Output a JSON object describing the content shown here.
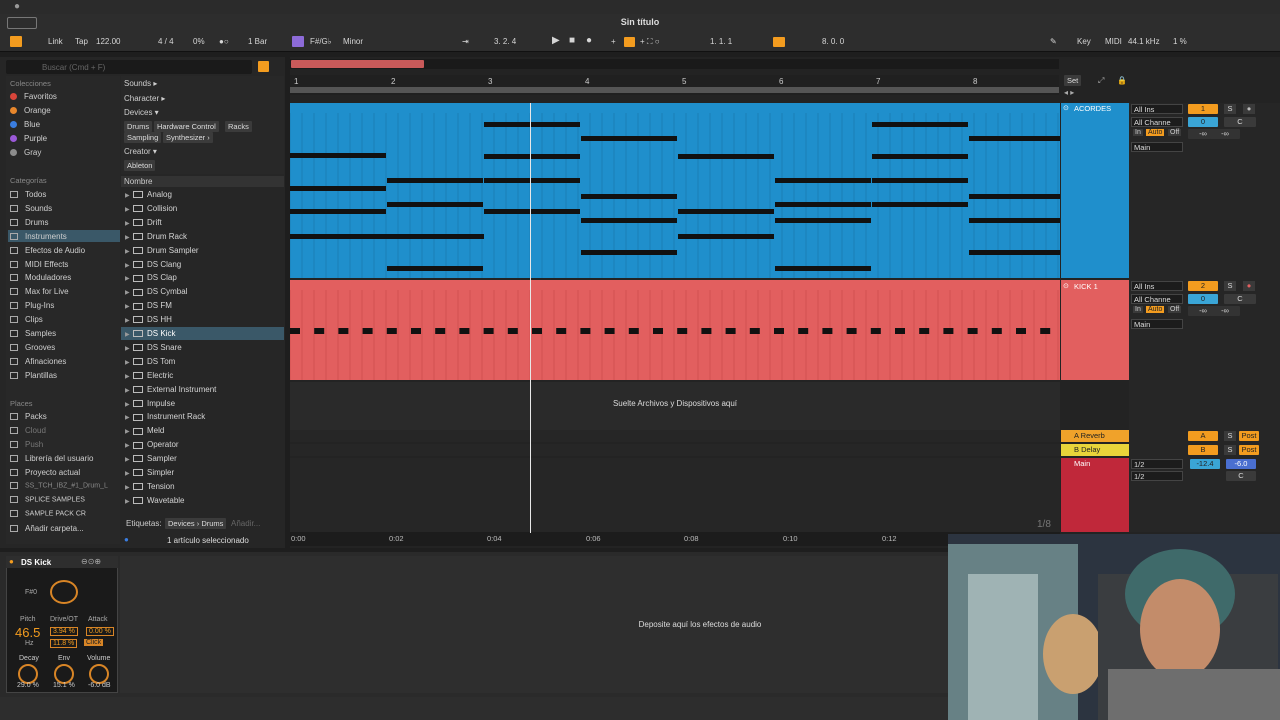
{
  "app": {
    "title": "Sin título"
  },
  "control_bar": {
    "link": "Link",
    "tap": "Tap",
    "tempo": "122.00",
    "signature": "4 / 4",
    "percent": "0%",
    "quantize": "1 Bar",
    "key": "F#/G♭",
    "scale": "Minor",
    "position": "3.  2.  4",
    "loop_start": "1.  1.  1",
    "loop_length": "8.  0.  0",
    "key_btn": "Key",
    "midi_btn": "MIDI",
    "sample_rate": "44.1 kHz",
    "cpu": "1 %"
  },
  "browser": {
    "search_placeholder": "Buscar (Cmd + F)",
    "collections_head": "Colecciones",
    "collections": [
      {
        "label": "Favoritos",
        "color": "#d8453a"
      },
      {
        "label": "Orange",
        "color": "#e8872c"
      },
      {
        "label": "Blue",
        "color": "#3a7de0"
      },
      {
        "label": "Purple",
        "color": "#9b59d8"
      },
      {
        "label": "Gray",
        "color": "#8c8c8c"
      }
    ],
    "categories_head": "Categorías",
    "categories": [
      "Todos",
      "Sounds",
      "Drums",
      "Instruments",
      "Efectos de Audio",
      "MIDI Effects",
      "Moduladores",
      "Max for Live",
      "Plug-Ins",
      "Clips",
      "Samples",
      "Grooves",
      "Afinaciones",
      "Plantillas"
    ],
    "places_head": "Places",
    "places": [
      "Packs",
      "Cloud",
      "Push",
      "Librería del usuario",
      "Proyecto actual",
      "SS_TCH_IBZ_#1_Drum_L",
      "SPLICE SAMPLES",
      "SAMPLE PACK CR",
      "Añadir carpeta..."
    ],
    "filters": {
      "sounds": "Sounds ▸",
      "character": "Character ▸",
      "devices": "Devices ▾",
      "device_tags": [
        "Drums",
        "Hardware Control",
        "Racks",
        "Sampling",
        "Synthesizer ›"
      ],
      "creator": "Creator ▾",
      "creator_tags": [
        "Ableton"
      ]
    },
    "name_header": "Nombre",
    "items": [
      "Analog",
      "Collision",
      "Drift",
      "Drum Rack",
      "Drum Sampler",
      "DS Clang",
      "DS Clap",
      "DS Cymbal",
      "DS FM",
      "DS HH",
      "DS Kick",
      "DS Snare",
      "DS Tom",
      "Electric",
      "External Instrument",
      "Impulse",
      "Instrument Rack",
      "Meld",
      "Operator",
      "Sampler",
      "Simpler",
      "Tension",
      "Wavetable"
    ],
    "tags_label": "Etiquetas:",
    "tags_path": "Devices › Drums",
    "tags_add": "Añadir...",
    "status": "1 artículo seleccionado"
  },
  "arrangement": {
    "ruler": [
      "1",
      "2",
      "3",
      "4",
      "5",
      "6",
      "7",
      "8"
    ],
    "times": [
      "0:00",
      "0:02",
      "0:04",
      "0:06",
      "0:08",
      "0:10",
      "0:12"
    ],
    "set_btn": "Set",
    "drop_text": "Suelte Archivos y Dispositivos aquí",
    "zoom_label": "1/8",
    "colors": {
      "acordes": "#1f8fcc",
      "kick": "#e25f5f",
      "main": "#c0283a",
      "reverb": "#f0a22a",
      "delay": "#e9d43a"
    }
  },
  "tracks": [
    {
      "name": "ACORDES",
      "input": "All Ins",
      "channel": "All Channe",
      "num": "1",
      "vol": "0",
      "pan": "C",
      "out": "Main"
    },
    {
      "name": "KICK 1",
      "input": "All Ins",
      "channel": "All Channe",
      "num": "2",
      "vol": "0",
      "pan": "C",
      "out": "Main"
    }
  ],
  "returns": [
    {
      "name": "A Reverb",
      "letter": "A"
    },
    {
      "name": "B Delay",
      "letter": "B"
    }
  ],
  "master": {
    "name": "Main",
    "sel1": "1/2",
    "sel2": "1/2",
    "vol": "-12.4",
    "vol2": "-6.0",
    "pan": "C"
  },
  "mixer_labels": {
    "solo": "S",
    "post": "Post",
    "in": "In",
    "auto": "Auto",
    "off": "Off",
    "inf": "-∞"
  },
  "device": {
    "name": "DS Kick",
    "note": "F#0",
    "pitch_label": "Pitch",
    "pitch": "46.5",
    "pitch_unit": "Hz",
    "drive_label": "Drive/OT",
    "drive": "3.94 %",
    "drive2": "11.8 %",
    "attack_label": "Attack",
    "attack": "0.00 %",
    "click": "Click",
    "decay_label": "Decay",
    "decay": "29.0 %",
    "env_label": "Env",
    "env": "15.1 %",
    "volume_label": "Volume",
    "volume": "-6.0 dB"
  },
  "fx_drop": "Deposite aquí los efectos de audio"
}
